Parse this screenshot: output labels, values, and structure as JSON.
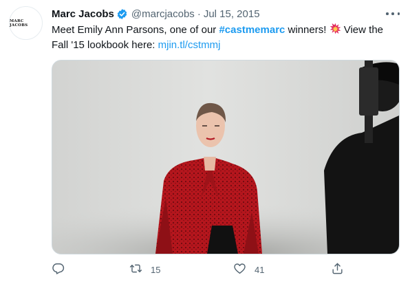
{
  "tweet": {
    "avatar_text": "MARC JACOBS",
    "display_name": "Marc Jacobs",
    "handle": "@marcjacobs",
    "separator": "·",
    "date": "Jul 15, 2015",
    "text_pre": "Meet Emily Ann Parsons, one of our ",
    "hashtag": "#castmemarc",
    "text_mid": " winners! ",
    "text_post": " View the Fall '15 lookbook here: ",
    "link": "mjin.tl/cstmmj"
  },
  "actions": {
    "retweet_count": "15",
    "like_count": "41"
  },
  "colors": {
    "accent": "#1d9bf0",
    "secondary_text": "#536471",
    "verified": "#1d9bf0",
    "spark": "#e0245e"
  },
  "icons": {
    "verified": "verified-badge-icon",
    "more": "more-icon",
    "reply": "reply-icon",
    "retweet": "retweet-icon",
    "like": "heart-icon",
    "share": "share-icon",
    "spark": "collision-emoji-icon"
  }
}
